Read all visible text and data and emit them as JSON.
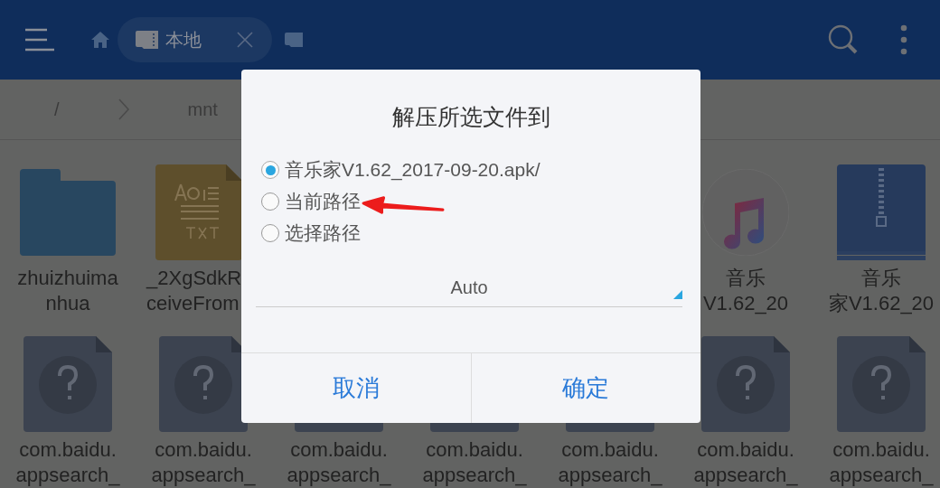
{
  "app_bar": {
    "tab": {
      "label": "本地"
    }
  },
  "breadcrumb": [
    {
      "label": "/"
    },
    {
      "label": "mnt"
    }
  ],
  "file_rows": [
    [
      {
        "kind": "folder",
        "lines": [
          "zhuizhuima",
          "nhua"
        ]
      },
      {
        "kind": "txt",
        "lines": [
          "_2XgSdkR",
          "ceiveFrom"
        ]
      },
      null,
      null,
      null,
      {
        "kind": "music",
        "lines": [
          "音乐",
          "V1.62_20"
        ]
      },
      {
        "kind": "zip",
        "lines": [
          "音乐",
          "家V1.62_20"
        ]
      }
    ],
    [
      {
        "kind": "unknown",
        "lines": [
          "com.baidu.",
          "appsearch_"
        ]
      },
      {
        "kind": "unknown",
        "lines": [
          "com.baidu.",
          "appsearch_"
        ]
      },
      {
        "kind": "unknown",
        "lines": [
          "com.baidu.",
          "appsearch_"
        ]
      },
      {
        "kind": "unknown",
        "lines": [
          "com.baidu.",
          "appsearch_"
        ]
      },
      {
        "kind": "unknown",
        "lines": [
          "com.baidu.",
          "appsearch_"
        ]
      },
      {
        "kind": "unknown",
        "lines": [
          "com.baidu.",
          "appsearch_"
        ]
      },
      {
        "kind": "unknown",
        "lines": [
          "com.baidu.",
          "appsearch_"
        ]
      }
    ]
  ],
  "dialog": {
    "title": "解压所选文件到",
    "options": [
      {
        "label": "音乐家V1.62_2017-09-20.apk/",
        "selected": true
      },
      {
        "label": "当前路径",
        "selected": false
      },
      {
        "label": "选择路径",
        "selected": false
      }
    ],
    "dropdown": {
      "value": "Auto"
    },
    "buttons": [
      "取消",
      "确定"
    ]
  }
}
